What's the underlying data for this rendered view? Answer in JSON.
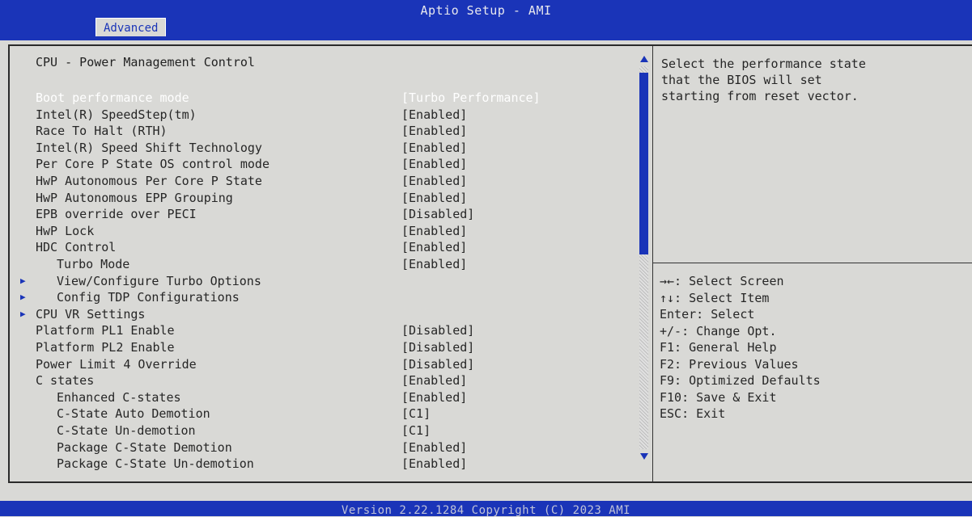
{
  "header": {
    "title": "Aptio Setup - AMI",
    "active_tab": "Advanced"
  },
  "page": {
    "section_title": "CPU - Power Management Control"
  },
  "settings": [
    {
      "label": "Boot performance mode",
      "value": "[Turbo Performance]",
      "indent": 0,
      "submenu": false,
      "selected": true
    },
    {
      "label": "Intel(R) SpeedStep(tm)",
      "value": "[Enabled]",
      "indent": 0,
      "submenu": false,
      "selected": false
    },
    {
      "label": "Race To Halt (RTH)",
      "value": "[Enabled]",
      "indent": 0,
      "submenu": false,
      "selected": false
    },
    {
      "label": "Intel(R) Speed Shift Technology",
      "value": "[Enabled]",
      "indent": 0,
      "submenu": false,
      "selected": false
    },
    {
      "label": "Per Core P State OS control mode",
      "value": "[Enabled]",
      "indent": 0,
      "submenu": false,
      "selected": false
    },
    {
      "label": "HwP Autonomous Per Core P State",
      "value": "[Enabled]",
      "indent": 0,
      "submenu": false,
      "selected": false
    },
    {
      "label": "HwP Autonomous EPP Grouping",
      "value": "[Enabled]",
      "indent": 0,
      "submenu": false,
      "selected": false
    },
    {
      "label": "EPB override over PECI",
      "value": "[Disabled]",
      "indent": 0,
      "submenu": false,
      "selected": false
    },
    {
      "label": "HwP Lock",
      "value": "[Enabled]",
      "indent": 0,
      "submenu": false,
      "selected": false
    },
    {
      "label": "HDC Control",
      "value": "[Enabled]",
      "indent": 0,
      "submenu": false,
      "selected": false
    },
    {
      "label": "Turbo Mode",
      "value": "[Enabled]",
      "indent": 1,
      "submenu": false,
      "selected": false
    },
    {
      "label": "View/Configure Turbo Options",
      "value": "",
      "indent": 1,
      "submenu": true,
      "selected": false
    },
    {
      "label": "Config TDP Configurations",
      "value": "",
      "indent": 1,
      "submenu": true,
      "selected": false
    },
    {
      "label": "CPU VR Settings",
      "value": "",
      "indent": 0,
      "submenu": true,
      "selected": false
    },
    {
      "label": "Platform PL1 Enable",
      "value": "[Disabled]",
      "indent": 0,
      "submenu": false,
      "selected": false
    },
    {
      "label": "Platform PL2 Enable",
      "value": "[Disabled]",
      "indent": 0,
      "submenu": false,
      "selected": false
    },
    {
      "label": "Power Limit 4 Override",
      "value": "[Disabled]",
      "indent": 0,
      "submenu": false,
      "selected": false
    },
    {
      "label": "C states",
      "value": "[Enabled]",
      "indent": 0,
      "submenu": false,
      "selected": false
    },
    {
      "label": "Enhanced C-states",
      "value": "[Enabled]",
      "indent": 1,
      "submenu": false,
      "selected": false
    },
    {
      "label": "C-State Auto Demotion",
      "value": "[C1]",
      "indent": 1,
      "submenu": false,
      "selected": false
    },
    {
      "label": "C-State Un-demotion",
      "value": "[C1]",
      "indent": 1,
      "submenu": false,
      "selected": false
    },
    {
      "label": "Package C-State Demotion",
      "value": "[Enabled]",
      "indent": 1,
      "submenu": false,
      "selected": false
    },
    {
      "label": "Package C-State Un-demotion",
      "value": "[Enabled]",
      "indent": 1,
      "submenu": false,
      "selected": false
    }
  ],
  "help": {
    "text": "Select the performance state\nthat the BIOS will set\nstarting from reset vector."
  },
  "keys": [
    "→←: Select Screen",
    "↑↓: Select Item",
    "Enter: Select",
    "+/-: Change Opt.",
    "F1: General Help",
    "F2: Previous Values",
    "F9: Optimized Defaults",
    "F10: Save & Exit",
    "ESC: Exit"
  ],
  "footer": {
    "text": "Version 2.22.1284 Copyright (C) 2023 AMI"
  },
  "colors": {
    "bar_blue": "#1a34b8",
    "panel_gray": "#d9d9d6",
    "text": "#262626",
    "selected_text": "#ffffff"
  }
}
